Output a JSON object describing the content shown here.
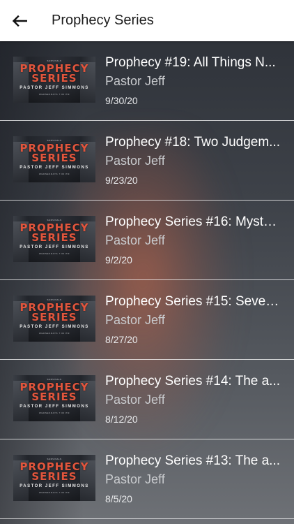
{
  "header": {
    "title": "Prophecy Series",
    "back_icon": "arrow-left-icon"
  },
  "thumbnail": {
    "small_text": "SURVIVALS",
    "title_line1": "PROPHECY",
    "title_line2": "SERIES",
    "pastor_line": "PASTOR JEFF SIMMONS",
    "footer_line": "WEDNESDAYS 7:00 PM"
  },
  "colors": {
    "header_bg": "#ffffff",
    "thumb_title": "#e2553c",
    "divider": "#ffffff"
  },
  "sermons": [
    {
      "title": "Prophecy #19: All Things N...",
      "speaker": "Pastor Jeff",
      "date": "9/30/20"
    },
    {
      "title": "Prophecy #18: Two Judgem...",
      "speaker": "Pastor Jeff",
      "date": "9/23/20"
    },
    {
      "title": "Prophecy Series #16: Myste...",
      "speaker": "Pastor Jeff",
      "date": "9/2/20"
    },
    {
      "title": "Prophecy Series #15: Seven...",
      "speaker": "Pastor Jeff",
      "date": "8/27/20"
    },
    {
      "title": "Prophecy Series #14: The a...",
      "speaker": "Pastor Jeff",
      "date": "8/12/20"
    },
    {
      "title": "Prophecy Series #13: The a...",
      "speaker": "Pastor Jeff",
      "date": "8/5/20"
    }
  ]
}
